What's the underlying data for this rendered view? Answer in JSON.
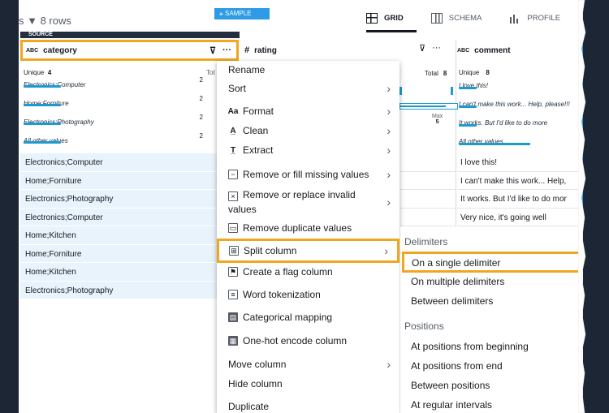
{
  "toolbar": {
    "rows_text": "s ▼  8 rows",
    "sample_tab": "⚹ SAMPLE",
    "source_tab": "SOURCE",
    "view_tabs": [
      {
        "label": "GRID",
        "icon": "grid-icon",
        "active": true
      },
      {
        "label": "SCHEMA",
        "icon": "schema-icon",
        "active": false
      },
      {
        "label": "PROFILE",
        "icon": "profile-icon",
        "active": false
      }
    ]
  },
  "columns": {
    "category": {
      "type": "ABC",
      "name": "category",
      "unique_label": "Unique",
      "unique_count": "4",
      "total_label": "Tot",
      "profile": [
        {
          "label": "Electronics;Computer",
          "count": "2"
        },
        {
          "label": "Home;Forniture",
          "count": "2"
        },
        {
          "label": "Electronics;Photography",
          "count": "2"
        },
        {
          "label": "All other values",
          "count": "2"
        }
      ],
      "cells": [
        "Electronics;Computer",
        "Home;Forniture",
        "Electronics;Photography",
        "Electronics;Computer",
        "Home;Kitchen",
        "Home;Forniture",
        "Home;Kitchen",
        "Electronics;Photography"
      ]
    },
    "rating": {
      "type": "#",
      "name": "rating",
      "total_label": "Total",
      "total_count": "8",
      "max_label": "Max",
      "max_value": "5"
    },
    "comment": {
      "type": "ABC",
      "name": "comment",
      "unique_label": "Unique",
      "unique_count": "8",
      "profile": [
        "I love this!",
        "I can't make this work... Help, please!!!",
        "It works. But I'd like to do more",
        "All other values"
      ],
      "cells": [
        "I love this!",
        "I can't make this work... Help,",
        "It works. But I'd like to do mor",
        "Very nice, it's going well"
      ]
    }
  },
  "menu": {
    "items": [
      {
        "label": "Rename",
        "icon": "",
        "submenu": false
      },
      {
        "label": "Sort",
        "icon": "",
        "submenu": true
      },
      {
        "label": "Format",
        "icon": "format-icon",
        "submenu": true
      },
      {
        "label": "Clean",
        "icon": "clean-icon",
        "submenu": true
      },
      {
        "label": "Extract",
        "icon": "extract-icon",
        "submenu": true
      },
      {
        "label": "Remove or fill missing values",
        "icon": "missing-values-icon",
        "submenu": true
      },
      {
        "label": "Remove or replace invalid values",
        "icon": "invalid-values-icon",
        "submenu": true
      },
      {
        "label": "Remove duplicate values",
        "icon": "duplicate-values-icon",
        "submenu": false
      },
      {
        "label": "Split column",
        "icon": "split-column-icon",
        "submenu": true
      },
      {
        "label": "Create a flag column",
        "icon": "flag-column-icon",
        "submenu": false
      },
      {
        "label": "Word tokenization",
        "icon": "word-tokenization-icon",
        "submenu": false
      },
      {
        "label": "Categorical mapping",
        "icon": "categorical-mapping-icon",
        "submenu": false
      },
      {
        "label": "One-hot encode column",
        "icon": "one-hot-encode-icon",
        "submenu": false
      },
      {
        "label": "Move column",
        "icon": "",
        "submenu": true
      },
      {
        "label": "Hide column",
        "icon": "",
        "submenu": false
      },
      {
        "label": "Duplicate",
        "icon": "",
        "submenu": false
      }
    ]
  },
  "submenu": {
    "delimiters_heading": "Delimiters",
    "delimiter_items": [
      "On a single delimiter",
      "On multiple delimiters",
      "Between delimiters"
    ],
    "positions_heading": "Positions",
    "position_items": [
      "At positions from beginning",
      "At positions from end",
      "Between positions",
      "At regular intervals"
    ]
  },
  "colors": {
    "highlight": "#f1a622",
    "accent": "#1c9bd1",
    "background": "#1d2634"
  }
}
